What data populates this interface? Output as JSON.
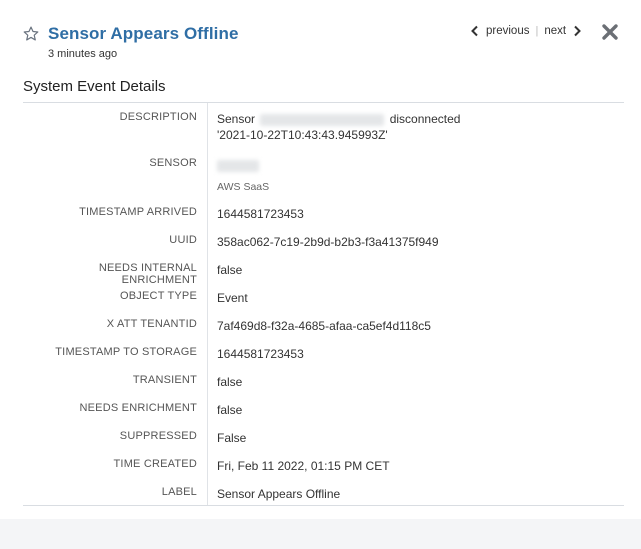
{
  "header": {
    "star_icon": "star-outline-icon",
    "title": "Sensor Appears Offline",
    "subtitle": "3 minutes ago",
    "previous_label": "previous",
    "next_label": "next",
    "close_icon": "close-x-icon"
  },
  "section_title": "System Event Details",
  "details": {
    "description_label": "DESCRIPTION",
    "description_prefix": "Sensor",
    "description_suffix": "disconnected '2021-10-22T10:43:43.945993Z'",
    "sensor_label": "SENSOR",
    "sensor_sub": "AWS SaaS",
    "timestamp_arrived_label": "TIMESTAMP ARRIVED",
    "timestamp_arrived": "1644581723453",
    "uuid_label": "UUID",
    "uuid": "358ac062-7c19-2b9d-b2b3-f3a41375f949",
    "needs_internal_enrichment_label": "NEEDS INTERNAL ENRICHMENT",
    "needs_internal_enrichment": "false",
    "object_type_label": "OBJECT TYPE",
    "object_type": "Event",
    "x_att_tenantid_label": "X ATT TENANTID",
    "x_att_tenantid": "7af469d8-f32a-4685-afaa-ca5ef4d118c5",
    "timestamp_to_storage_label": "TIMESTAMP TO STORAGE",
    "timestamp_to_storage": "1644581723453",
    "transient_label": "TRANSIENT",
    "transient": "false",
    "needs_enrichment_label": "NEEDS ENRICHMENT",
    "needs_enrichment": "false",
    "suppressed_label": "SUPPRESSED",
    "suppressed": "False",
    "time_created_label": "TIME CREATED",
    "time_created": "Fri, Feb 11 2022, 01:15 PM CET",
    "label_label": "LABEL",
    "label": "Sensor Appears Offline"
  }
}
